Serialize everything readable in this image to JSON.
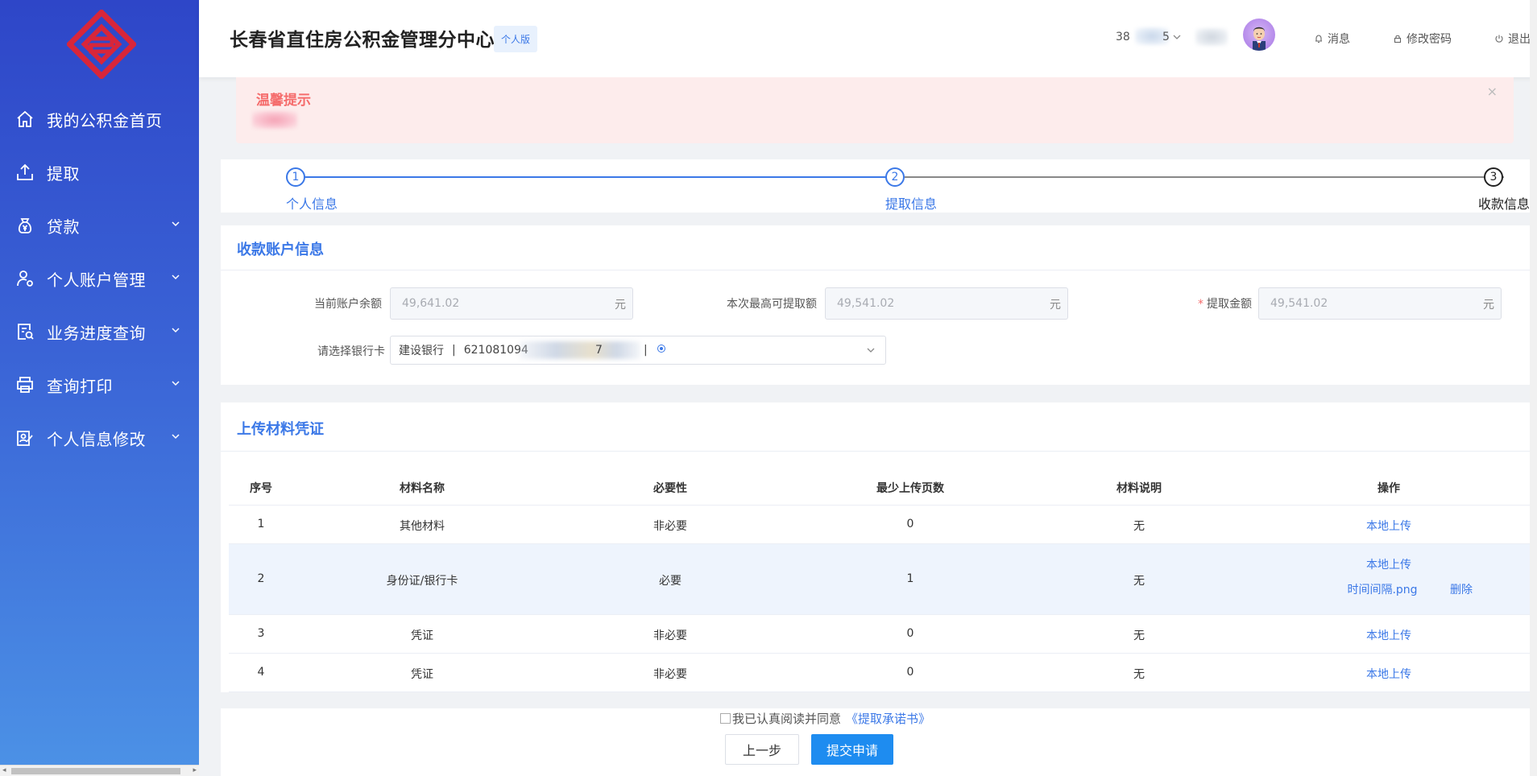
{
  "sidebar": {
    "items": [
      {
        "label": "我的公积金首页",
        "icon": "home-icon",
        "has_arrow": false
      },
      {
        "label": "提取",
        "icon": "upload-icon",
        "has_arrow": false
      },
      {
        "label": "贷款",
        "icon": "money-bag-icon",
        "has_arrow": true
      },
      {
        "label": "个人账户管理",
        "icon": "user-settings-icon",
        "has_arrow": true
      },
      {
        "label": "业务进度查询",
        "icon": "progress-search-icon",
        "has_arrow": true
      },
      {
        "label": "查询打印",
        "icon": "printer-icon",
        "has_arrow": true
      },
      {
        "label": "个人信息修改",
        "icon": "edit-profile-icon",
        "has_arrow": true
      }
    ]
  },
  "header": {
    "title": "长春省直住房公积金管理分中心",
    "edition": "个人版",
    "user_id": "38",
    "user_id_tail": "5",
    "messages": "消息",
    "change_password": "修改密码",
    "logout": "退出"
  },
  "notice": {
    "title": "温馨提示",
    "close": "×"
  },
  "steps": {
    "items": [
      {
        "num": "1",
        "label": "个人信息"
      },
      {
        "num": "2",
        "label": "提取信息"
      },
      {
        "num": "3",
        "label": "收款信息"
      }
    ]
  },
  "account": {
    "title": "收款账户信息",
    "balance_label": "当前账户余额",
    "balance_value": "49,641.02",
    "max_label": "本次最高可提取额",
    "max_value": "49,541.02",
    "amount_label": "提取金额",
    "amount_value": "49,541.02",
    "unit": "元",
    "bank_label": "请选择银行卡",
    "bank_name": "建设银行",
    "bank_sep": "|",
    "bank_card_prefix": "621081094",
    "bank_card_tail": "7"
  },
  "materials": {
    "title": "上传材料凭证",
    "columns": [
      "序号",
      "材料名称",
      "必要性",
      "最少上传页数",
      "材料说明",
      "操作"
    ],
    "rows": [
      {
        "no": "1",
        "name": "其他材料",
        "required": "非必要",
        "min_pages": "0",
        "desc": "无",
        "action": "本地上传"
      },
      {
        "no": "2",
        "name": "身份证/银行卡",
        "required": "必要",
        "min_pages": "1",
        "desc": "无",
        "action": "本地上传",
        "file": "时间间隔.png",
        "delete": "删除"
      },
      {
        "no": "3",
        "name": "凭证",
        "required": "非必要",
        "min_pages": "0",
        "desc": "无",
        "action": "本地上传"
      },
      {
        "no": "4",
        "name": "凭证",
        "required": "非必要",
        "min_pages": "0",
        "desc": "无",
        "action": "本地上传"
      }
    ]
  },
  "footer": {
    "agree_text": "我已认真阅读并同意",
    "agree_link": "《提取承诺书》",
    "prev_button": "上一步",
    "submit_button": "提交申请"
  },
  "colors": {
    "accent": "#3b78e7",
    "submit": "#1e8cf0",
    "notice_bg": "#fdecec",
    "notice_title": "#f56c6c"
  }
}
